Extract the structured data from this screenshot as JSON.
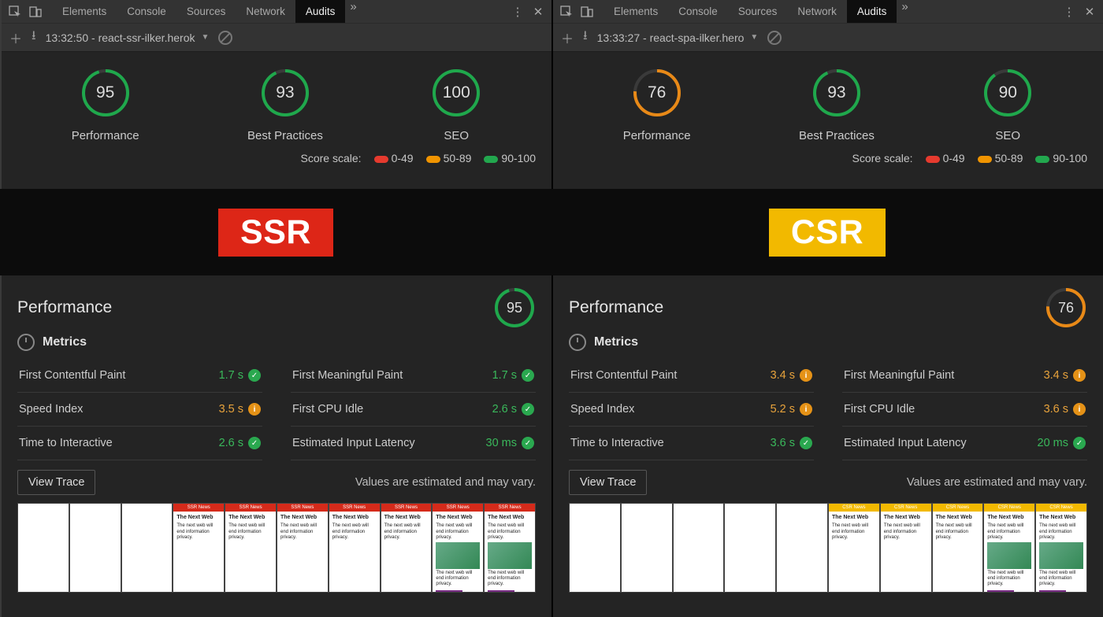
{
  "devtools": {
    "tabs": [
      "Elements",
      "Console",
      "Sources",
      "Network",
      "Audits"
    ],
    "activeTab": "Audits",
    "left": {
      "auditTitle": "13:32:50 - react-ssr-ilker.herok"
    },
    "right": {
      "auditTitle": "13:33:27 - react-spa-ilker.hero"
    }
  },
  "scoreScale": {
    "label": "Score scale:",
    "ranges": [
      "0-49",
      "50-89",
      "90-100"
    ]
  },
  "ssr": {
    "badge": "SSR",
    "scores": [
      {
        "name": "Performance",
        "value": 95,
        "color": "#1fa84c"
      },
      {
        "name": "Best Practices",
        "value": 93,
        "color": "#1fa84c"
      },
      {
        "name": "SEO",
        "value": 100,
        "color": "#1fa84c"
      }
    ],
    "perf": {
      "title": "Performance",
      "score": 95,
      "scoreColor": "#1fa84c",
      "metricsTitle": "Metrics",
      "metrics": [
        {
          "name": "First Contentful Paint",
          "value": "1.7 s",
          "status": "ok"
        },
        {
          "name": "First Meaningful Paint",
          "value": "1.7 s",
          "status": "ok"
        },
        {
          "name": "Speed Index",
          "value": "3.5 s",
          "status": "warn"
        },
        {
          "name": "First CPU Idle",
          "value": "2.6 s",
          "status": "ok"
        },
        {
          "name": "Time to Interactive",
          "value": "2.6 s",
          "status": "ok"
        },
        {
          "name": "Estimated Input Latency",
          "value": "30 ms",
          "status": "ok"
        }
      ],
      "viewTrace": "View Trace",
      "disclaimer": "Values are estimated and may vary."
    }
  },
  "csr": {
    "badge": "CSR",
    "scores": [
      {
        "name": "Performance",
        "value": 76,
        "color": "#e88917"
      },
      {
        "name": "Best Practices",
        "value": 93,
        "color": "#1fa84c"
      },
      {
        "name": "SEO",
        "value": 90,
        "color": "#1fa84c"
      }
    ],
    "perf": {
      "title": "Performance",
      "score": 76,
      "scoreColor": "#e88917",
      "metricsTitle": "Metrics",
      "metrics": [
        {
          "name": "First Contentful Paint",
          "value": "3.4 s",
          "status": "warn"
        },
        {
          "name": "First Meaningful Paint",
          "value": "3.4 s",
          "status": "warn"
        },
        {
          "name": "Speed Index",
          "value": "5.2 s",
          "status": "warn"
        },
        {
          "name": "First CPU Idle",
          "value": "3.6 s",
          "status": "warn"
        },
        {
          "name": "Time to Interactive",
          "value": "3.6 s",
          "status": "ok"
        },
        {
          "name": "Estimated Input Latency",
          "value": "20 ms",
          "status": "ok"
        }
      ],
      "viewTrace": "View Trace",
      "disclaimer": "Values are estimated and may vary."
    }
  },
  "filmstrip": {
    "frameTitle": "The Next Web",
    "frameText": "The next web will end information privacy.",
    "ssrHeader": "SSR News",
    "csrHeader": "CSR News"
  }
}
